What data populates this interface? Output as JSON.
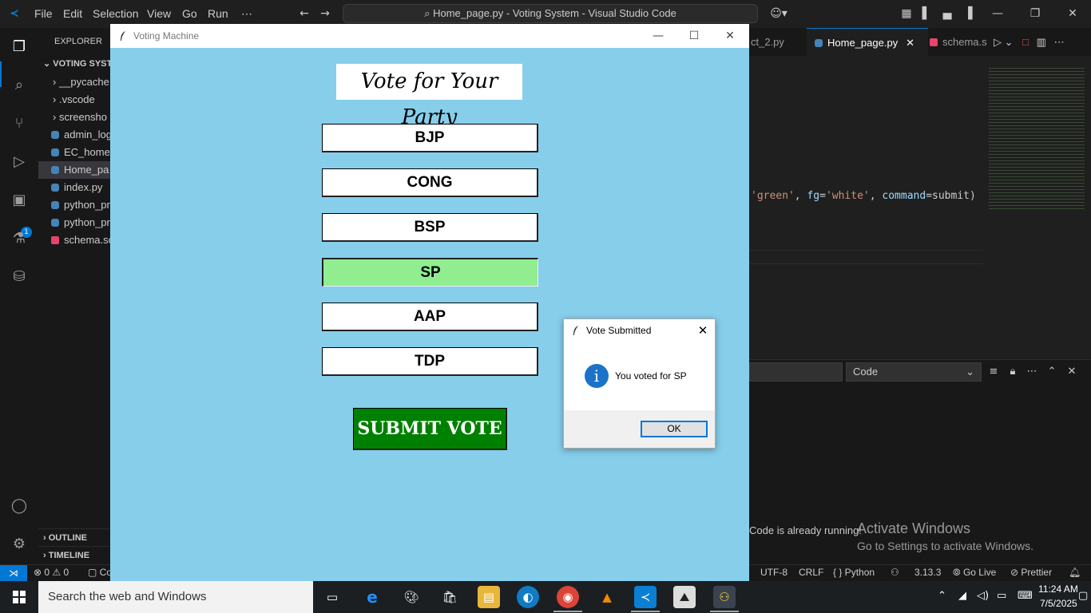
{
  "vscode": {
    "menu": [
      "File",
      "Edit",
      "Selection",
      "View",
      "Go",
      "Run",
      "⋯"
    ],
    "title_search": "Home_page.py - Voting System - Visual Studio Code",
    "explorer_header": "EXPLORER",
    "project": "VOTING SYST",
    "tree": [
      "__pycache",
      ".vscode",
      "screensho",
      "admin_log",
      "EC_home.",
      "Home_pa",
      "index.py",
      "python_pr",
      "python_pr",
      "schema.sc"
    ],
    "outline": "OUTLINE",
    "timeline": "TIMELINE",
    "extensions_badge": "1",
    "tabs": [
      "ct_2.py",
      "Home_page.py",
      "schema.s"
    ],
    "code_line_fragments": {
      "p1": "'green'",
      "p2": ", ",
      "p3": "fg",
      "p4": "=",
      "p5": "'white'",
      "p6": ", ",
      "p7": "command",
      "p8": "=submit)"
    },
    "output_channel": "Code",
    "toast": "Code is already running!",
    "watermark_title": "Activate Windows",
    "watermark_sub": "Go to Settings to activate Windows.",
    "status": {
      "problems": "⊗ 0 ⚠ 0",
      "left_frag": "Co",
      "encoding": "UTF-8",
      "eol": "CRLF",
      "language": "{ } Python",
      "version": "3.13.3",
      "golive": "Go Live",
      "prettier": "Prettier"
    },
    "colors": {
      "accent": "#0078d4",
      "string": "#ce9178",
      "param": "#9cdcfe"
    }
  },
  "tk_window": {
    "title": "Voting Machine",
    "heading": "Vote for Your Party",
    "parties": [
      "BJP",
      "CONG",
      "BSP",
      "SP",
      "AAP",
      "TDP"
    ],
    "selected_party": "SP",
    "submit_label": "SUBMIT VOTE",
    "colors": {
      "background": "#87ceeb",
      "selected": "#90ee90",
      "submit": "#008000"
    }
  },
  "message_box": {
    "title": "Vote Submitted",
    "message": "You voted for SP",
    "ok_label": "OK",
    "icon": "info-icon"
  },
  "taskbar": {
    "search_placeholder": "Search the web and Windows",
    "time": "11:24 AM",
    "date": "7/5/2025"
  }
}
